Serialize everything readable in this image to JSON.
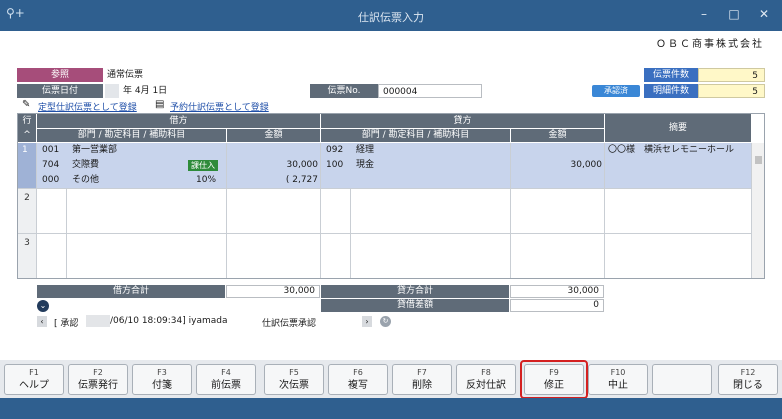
{
  "window": {
    "title": "仕訳伝票入力"
  },
  "company": "ＯＢＣ商事株式会社",
  "header": {
    "ref_label": "参照",
    "slip_type": "通常伝票",
    "date_label": "伝票日付",
    "date_value": "年  4月  1日",
    "slip_no_label": "伝票No.",
    "slip_no_value": "000004",
    "approved_badge": "承認済",
    "count_label": "伝票件数",
    "count_value": "5",
    "detail_label": "明細件数",
    "detail_value": "5",
    "link_fixed": "定型仕訳伝票として登録",
    "link_reserve": "予約仕訳伝票として登録"
  },
  "grid": {
    "row_header": "行",
    "debit_header": "借方",
    "credit_header": "貸方",
    "dept_header": "部門 / 勘定科目 / 補助科目",
    "amount_header": "金額",
    "summary_header": "摘要",
    "rows": [
      {
        "no": "1",
        "debit": [
          {
            "code": "001",
            "name": "第一営業部"
          },
          {
            "code": "704",
            "name": "交際費",
            "badge": "課仕入",
            "amount": "30,000"
          },
          {
            "code": "000",
            "name": "その他",
            "rate": "10%",
            "amount": "( 2,727"
          }
        ],
        "credit": [
          {
            "code": "092",
            "name": "経理"
          },
          {
            "code": "100",
            "name": "現金",
            "amount": "30,000"
          }
        ],
        "summary": "〇〇様　横浜セレモニーホール"
      },
      {
        "no": "2"
      },
      {
        "no": "3"
      }
    ]
  },
  "totals": {
    "debit_label": "借方合計",
    "debit_value": "30,000",
    "credit_label": "貸方合計",
    "credit_value": "30,000",
    "diff_label": "貸借差額",
    "diff_value": "0"
  },
  "approval": {
    "text": "[ 承認 ",
    "date": "/06/10 18:09:34]  iyamada",
    "approve_label": "仕訳伝票承認"
  },
  "fkeys": [
    {
      "key": "F1",
      "label": "ヘルプ"
    },
    {
      "key": "F2",
      "label": "伝票発行"
    },
    {
      "key": "F3",
      "label": "付箋"
    },
    {
      "key": "F4",
      "label": "前伝票"
    },
    {
      "key": "F5",
      "label": "次伝票"
    },
    {
      "key": "F6",
      "label": "複写"
    },
    {
      "key": "F7",
      "label": "削除"
    },
    {
      "key": "F8",
      "label": "反対仕訳"
    },
    {
      "key": "F9",
      "label": "修正"
    },
    {
      "key": "F10",
      "label": "中止"
    },
    {
      "key": "",
      "label": ""
    },
    {
      "key": "F12",
      "label": "閉じる"
    }
  ],
  "colors": {
    "titlebar": "#2f5f8f",
    "label_gray": "#5f6b78",
    "selected_row": "#c8d4ec",
    "highlight": "#d42020"
  }
}
